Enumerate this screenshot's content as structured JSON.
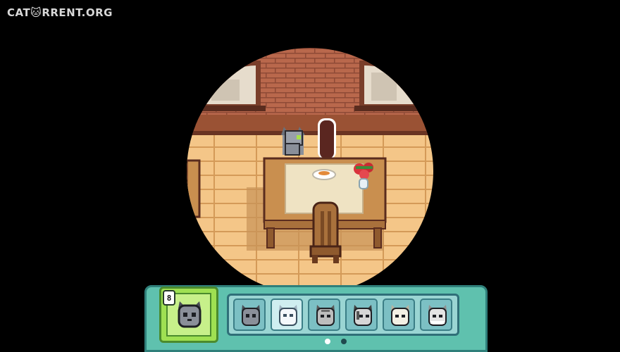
{
  "watermark": "CAT🐱RRENT.ORG",
  "scene": {
    "name": "dining-room"
  },
  "hud": {
    "selected_character": {
      "count": "8",
      "icon": "gray-cat-face-icon"
    },
    "roster": [
      {
        "icon": "gray-cat-face-icon",
        "active": false
      },
      {
        "icon": "white-cat-face-icon",
        "active": true
      },
      {
        "icon": "tabby-cat-face-icon",
        "active": false
      },
      {
        "icon": "striped-cat-face-icon",
        "active": false
      },
      {
        "icon": "cream-cat-face-icon",
        "active": false
      },
      {
        "icon": "white-fluffy-cat-face-icon",
        "active": false
      }
    ],
    "page_indicator": {
      "current": 1,
      "total": 2
    }
  },
  "colors": {
    "hud_teal": "#5fc1ae",
    "selected_green": "#9fe052",
    "floor": "#f2c486",
    "brick": "#b6644a"
  }
}
